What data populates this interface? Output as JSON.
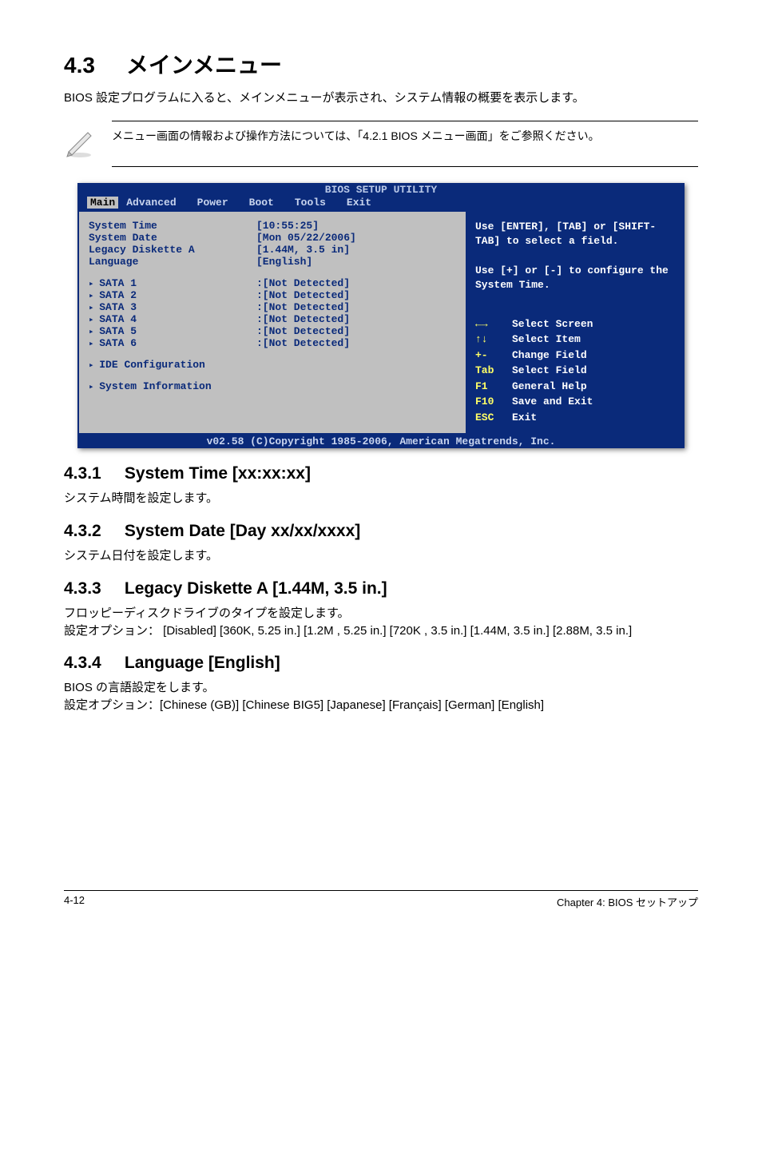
{
  "title": {
    "num": "4.3",
    "text": "メインメニュー"
  },
  "intro": "BIOS 設定プログラムに入ると、メインメニューが表示され、システム情報の概要を表示します。",
  "note": "メニュー画面の情報および操作方法については、「4.2.1  BIOS メニュー画面」をご参照ください。",
  "bios": {
    "header": "BIOS SETUP UTILITY",
    "tabs": [
      "Main",
      "Advanced",
      "Power",
      "Boot",
      "Tools",
      "Exit"
    ],
    "rows_top": [
      {
        "label": "System Time",
        "value": "[10:55:25]"
      },
      {
        "label": "System Date",
        "value": "[Mon 05/22/2006]"
      },
      {
        "label": "Legacy Diskette A",
        "value": "[1.44M, 3.5 in]"
      },
      {
        "label": "Language",
        "value": "[English]"
      }
    ],
    "rows_sata": [
      {
        "label": "SATA 1",
        "value": ":[Not Detected]"
      },
      {
        "label": "SATA 2",
        "value": ":[Not Detected]"
      },
      {
        "label": "SATA 3",
        "value": ":[Not Detected]"
      },
      {
        "label": "SATA 4",
        "value": ":[Not Detected]"
      },
      {
        "label": "SATA 5",
        "value": ":[Not Detected]"
      },
      {
        "label": "SATA 6",
        "value": ":[Not Detected]"
      }
    ],
    "rows_bottom": [
      {
        "label": "IDE Configuration"
      },
      {
        "label": "System Information"
      }
    ],
    "help_top": "Use [ENTER], [TAB] or [SHIFT-TAB] to select a field.\n\nUse [+] or [-] to configure the System Time.",
    "keys": [
      {
        "k": "arrows-lr",
        "d": "Select Screen"
      },
      {
        "k": "arrows-ud",
        "d": "Select Item"
      },
      {
        "k": "+-",
        "d": "Change Field"
      },
      {
        "k": "Tab",
        "d": "Select Field"
      },
      {
        "k": "F1",
        "d": "General Help"
      },
      {
        "k": "F10",
        "d": "Save and Exit"
      },
      {
        "k": "ESC",
        "d": "Exit"
      }
    ],
    "footer": "v02.58 (C)Copyright 1985-2006, American Megatrends, Inc."
  },
  "s431": {
    "num": "4.3.1",
    "title": "System Time [xx:xx:xx]",
    "body": "システム時間を設定します。"
  },
  "s432": {
    "num": "4.3.2",
    "title": "System Date [Day xx/xx/xxxx]",
    "body": "システム日付を設定します。"
  },
  "s433": {
    "num": "4.3.3",
    "title": "Legacy Diskette A [1.44M, 3.5 in.]",
    "body": "フロッピーディスクドライブのタイプを設定します。\n設定オプション： [Disabled] [360K, 5.25 in.] [1.2M , 5.25 in.] [720K , 3.5 in.] [1.44M, 3.5 in.] [2.88M, 3.5 in.]"
  },
  "s434": {
    "num": "4.3.4",
    "title": "Language [English]",
    "body": "BIOS の言語設定をします。\n設定オプション：[Chinese (GB)] [Chinese BIG5] [Japanese] [Français] [German] [English]"
  },
  "footer": {
    "left": "4-12",
    "right": "Chapter 4: BIOS セットアップ"
  }
}
